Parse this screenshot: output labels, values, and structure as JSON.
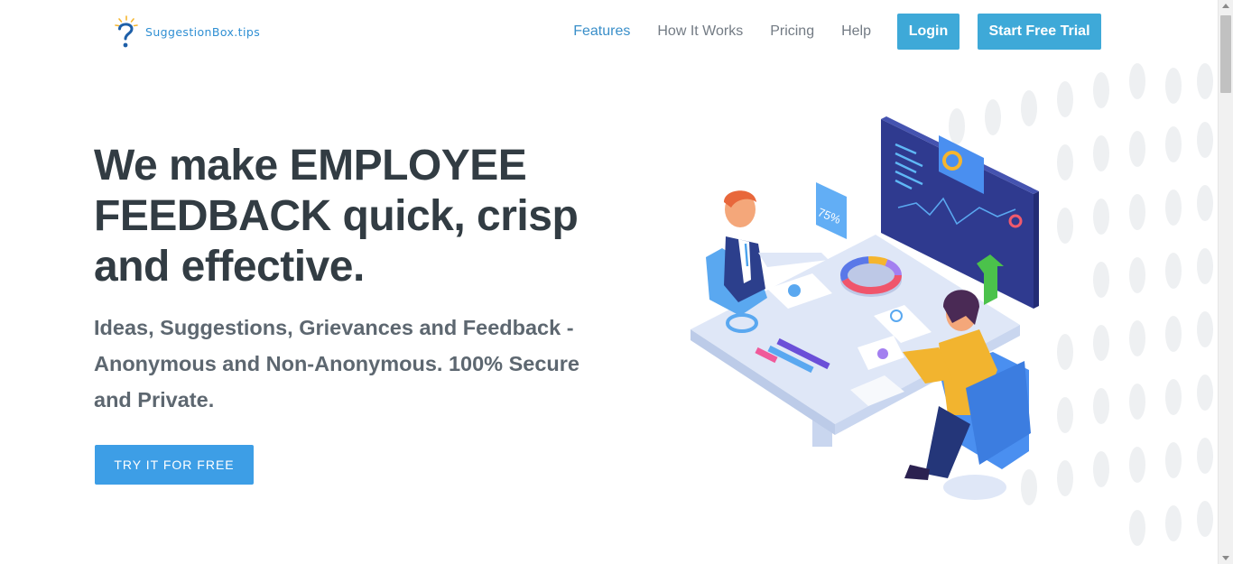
{
  "brand": {
    "name": "SuggestionBox.tips",
    "accent": "#3ea9d8"
  },
  "nav": {
    "items": [
      {
        "label": "Features",
        "active": true
      },
      {
        "label": "How It Works",
        "active": false
      },
      {
        "label": "Pricing",
        "active": false
      },
      {
        "label": "Help",
        "active": false
      }
    ],
    "login_label": "Login",
    "trial_label": "Start Free Trial"
  },
  "hero": {
    "title_line1": "We make EMPLOYEE",
    "title_line2": "FEEDBACK quick, crisp",
    "title_line3": "and effective.",
    "subtitle": "Ideas, Suggestions, Grievances and Feedback - Anonymous and Non-Anonymous. 100% Secure and Private.",
    "cta_label": "TRY IT FOR FREE"
  },
  "illustration": {
    "tag_value": "75%",
    "icons": [
      "question-mark-logo-icon",
      "meeting-illustration"
    ]
  }
}
